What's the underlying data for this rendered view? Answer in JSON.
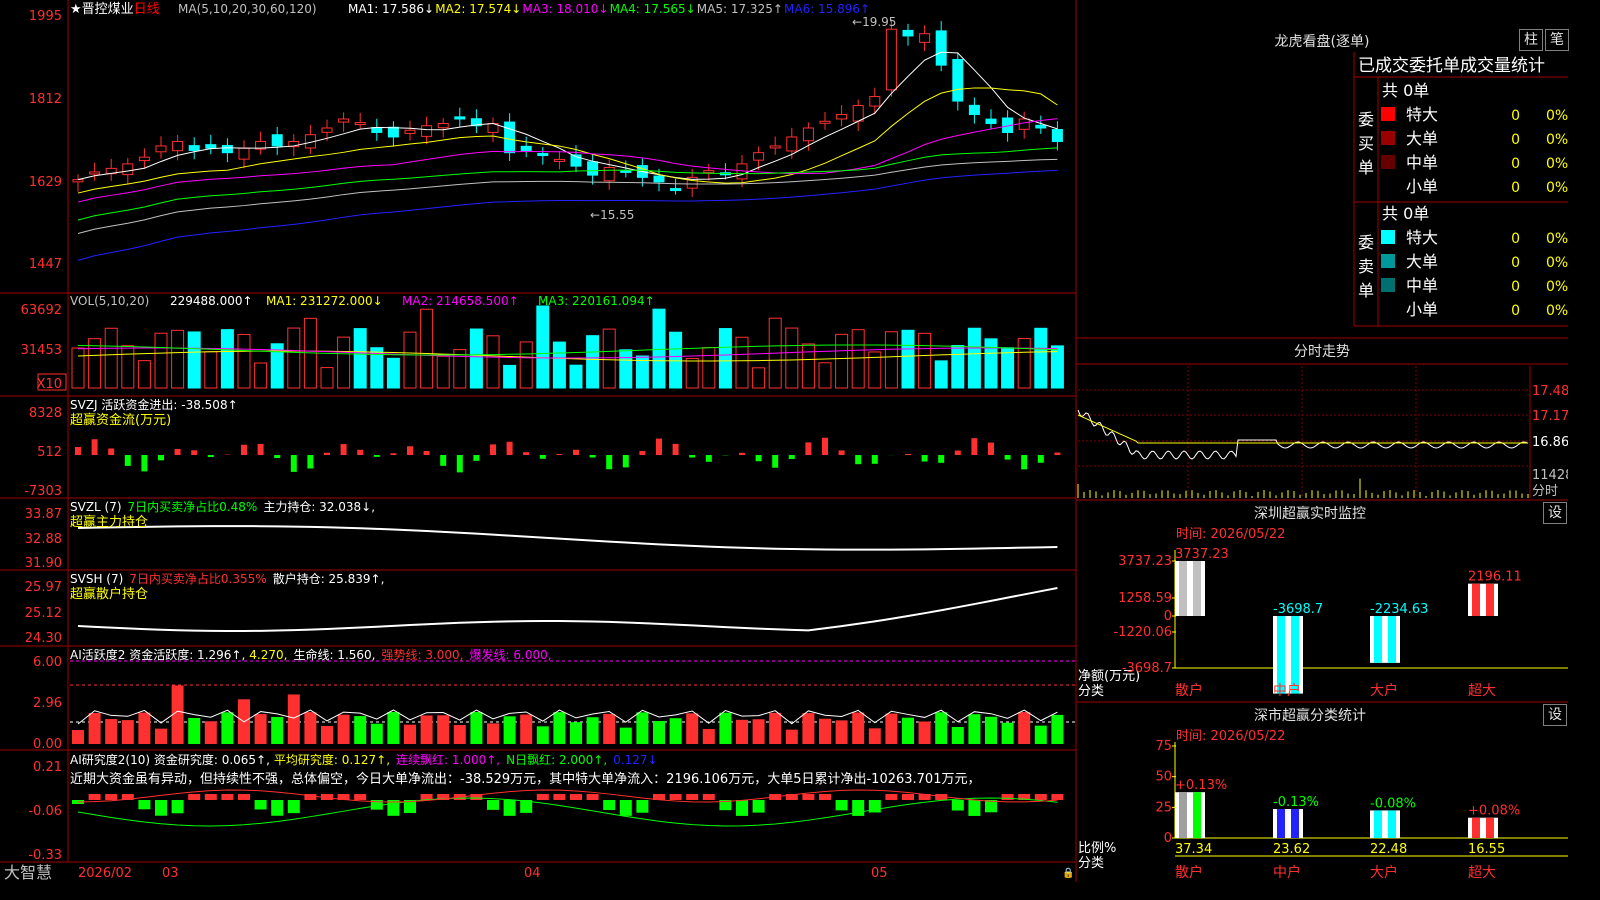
{
  "stock": {
    "name": "晋控煤业",
    "period": "日线",
    "star": "★"
  },
  "main_chart": {
    "ma_label": "MA(5,10,20,30,60,120)",
    "ma_items": [
      {
        "label": "MA1: 17.586↓",
        "color": "#ffffff"
      },
      {
        "label": "MA2: 17.574↓",
        "color": "#ffff00"
      },
      {
        "label": "MA3: 18.010↓",
        "color": "#ff00ff"
      },
      {
        "label": "MA4: 17.565↓",
        "color": "#00ff00"
      },
      {
        "label": "MA5: 17.325↑",
        "color": "#c0c0c0"
      },
      {
        "label": "MA6: 15.896↑",
        "color": "#2222ff"
      }
    ],
    "y_ticks": [
      "1995",
      "1812",
      "1629",
      "1447"
    ],
    "high_label": "19.95",
    "low_label": "15.55"
  },
  "vol_chart": {
    "title": "VOL(5,10,20)",
    "value": "229488.000↑",
    "ma1": "MA1: 231272.000↓",
    "ma2": "MA2: 214658.500↑",
    "ma3": "MA3: 220161.094↑",
    "y_ticks": [
      "63692",
      "31453"
    ],
    "unit": "X10"
  },
  "svzj_chart": {
    "title": "SVZJ  活跃资金进出: -38.508↑",
    "subtitle": "超赢资金流(万元)",
    "y_ticks": [
      "8328",
      "512",
      "-7303"
    ]
  },
  "svzl_chart": {
    "title": "SVZL (7)",
    "pct": "7日内买卖净占比0.48%",
    "hold": "主力持仓: 32.038↓,",
    "subtitle": "超赢主力持仓",
    "y_ticks": [
      "33.87",
      "32.88",
      "31.90"
    ]
  },
  "svsh_chart": {
    "title": "SVSH (7)",
    "pct": "7日内买卖净占比0.355%",
    "hold": "散户持仓: 25.839↑,",
    "subtitle": "超赢散户持仓",
    "y_ticks": [
      "25.97",
      "25.12",
      "24.30"
    ]
  },
  "ai_active": {
    "title": "AI活跃度2 资金活跃度: 1.296↑,",
    "v2": "4.270,",
    "life": "生命线: 1.560,",
    "strong": "强势线: 3.000,",
    "burst": "爆发线: 6.000,",
    "y_ticks": [
      "6.00",
      "2.96",
      "0.00"
    ]
  },
  "ai_research": {
    "title": "AI研究度2(10) 资金研究度: 0.065↑,",
    "avg": "平均研究度: 0.127↑,",
    "red": "连续飘红: 1.000↑,",
    "nred": "N日飘红: 2.000↑,",
    "last": "0.127↓",
    "comment": "近期大资金虽有异动，但持续性不强，总体偏空，今日大单净流出：-38.529万元，其中特大单净流入：2196.106万元，大单5日累计净出-10263.701万元，",
    "y_ticks": [
      "0.21",
      "-0.06",
      "-0.33"
    ]
  },
  "x_axis": {
    "brand": "大智慧",
    "labels": [
      "2026/02",
      "03",
      "04",
      "05"
    ]
  },
  "dragon": {
    "title": "龙虎看盘(逐单)",
    "btn_bar": "柱",
    "btn_line": "笔",
    "header": "已成交委托单成交量统计",
    "buy_label": "委买单",
    "sell_label": "委卖单",
    "buy_total": "共 0单",
    "sell_total": "共 0单",
    "buy_rows": [
      {
        "name": "特大",
        "count": "0",
        "pct": "0%",
        "color": "#ff0000"
      },
      {
        "name": "大单",
        "count": "0",
        "pct": "0%",
        "color": "#990000"
      },
      {
        "name": "中单",
        "count": "0",
        "pct": "0%",
        "color": "#660000"
      },
      {
        "name": "小单",
        "count": "0",
        "pct": "0%",
        "color": "#000000"
      }
    ],
    "sell_rows": [
      {
        "name": "特大",
        "count": "0",
        "pct": "0%",
        "color": "#00ffff"
      },
      {
        "name": "大单",
        "count": "0",
        "pct": "0%",
        "color": "#009999"
      },
      {
        "name": "中单",
        "count": "0",
        "pct": "0%",
        "color": "#006f6f"
      },
      {
        "name": "小单",
        "count": "0",
        "pct": "0%",
        "color": "#000000"
      }
    ]
  },
  "intraday": {
    "title": "分时走势",
    "y_ticks": [
      "17.48",
      "17.17",
      "16.86"
    ],
    "vol_tick": "11428",
    "vol_label": "分时"
  },
  "sz_monitor": {
    "title": "深圳超赢实时监控",
    "btn": "设",
    "time": "时间: 2026/05/22",
    "y_ticks": [
      "3737.23",
      "1258.59",
      "0",
      "-1220.06",
      "-3698.7"
    ],
    "axis_label_1": "净额(万元)",
    "axis_label_2": "分类",
    "categories": [
      "散户",
      "中户",
      "大户",
      "超大"
    ],
    "values": [
      3737.23,
      -3698.7,
      -2234.63,
      2196.11
    ],
    "value_labels": [
      "3737.23",
      "-3698.7",
      "-2234.63",
      "2196.11"
    ]
  },
  "sz_classify": {
    "title": "深市超赢分类统计",
    "btn": "设",
    "time": "时间: 2026/05/22",
    "y_ticks": [
      "75",
      "50",
      "25",
      "0"
    ],
    "axis_label_1": "比例%",
    "axis_label_2": "分类",
    "categories": [
      "散户",
      "中户",
      "大户",
      "超大"
    ],
    "values": [
      37.34,
      23.62,
      22.48,
      16.55
    ],
    "value_labels": [
      "37.34",
      "23.62",
      "22.48",
      "16.55"
    ],
    "change_labels": [
      "+0.13%",
      "-0.13%",
      "-0.08%",
      "+0.08%"
    ]
  },
  "chart_data": [
    {
      "type": "bar",
      "title": "深圳超赢实时监控",
      "ylabel": "净额(万元)",
      "categories": [
        "散户",
        "中户",
        "大户",
        "超大"
      ],
      "values": [
        3737.23,
        -3698.7,
        -2234.63,
        2196.11
      ],
      "ylim": [
        -3698.7,
        3737.23
      ]
    },
    {
      "type": "bar",
      "title": "深市超赢分类统计",
      "ylabel": "比例%",
      "categories": [
        "散户",
        "中户",
        "大户",
        "超大"
      ],
      "values": [
        37.34,
        23.62,
        22.48,
        16.55
      ],
      "ylim": [
        0,
        75
      ]
    }
  ]
}
